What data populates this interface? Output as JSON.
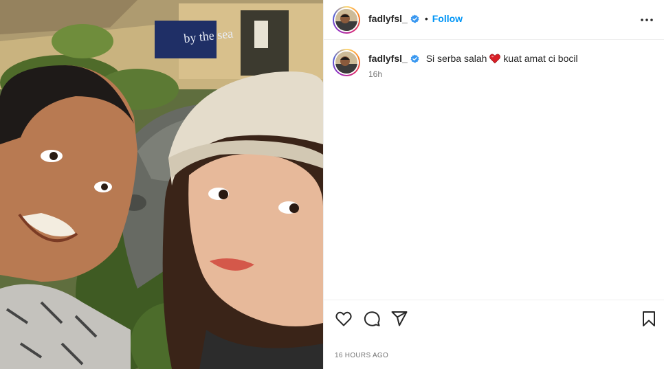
{
  "post": {
    "username": "fadlyfsl_",
    "follow_label": "Follow",
    "separator": "•",
    "caption": {
      "before_emoji": "Si serba salah",
      "after_emoji": "kuat amat ci bocil",
      "emoji": "red-heart"
    },
    "caption_age": "16h",
    "timestamp": "16 HOURS AGO"
  },
  "photo": {
    "sign_text": "by the sea"
  },
  "icons": {
    "verified": "verified-badge-icon",
    "more": "more-options-icon",
    "like": "heart-outline-icon",
    "comment": "comment-bubble-icon",
    "share": "paper-plane-icon",
    "save": "bookmark-icon"
  },
  "colors": {
    "link_blue": "#0095f6",
    "text_primary": "#262626",
    "text_secondary": "#737373",
    "verified_blue": "#3897f0",
    "divider": "#efefef"
  }
}
